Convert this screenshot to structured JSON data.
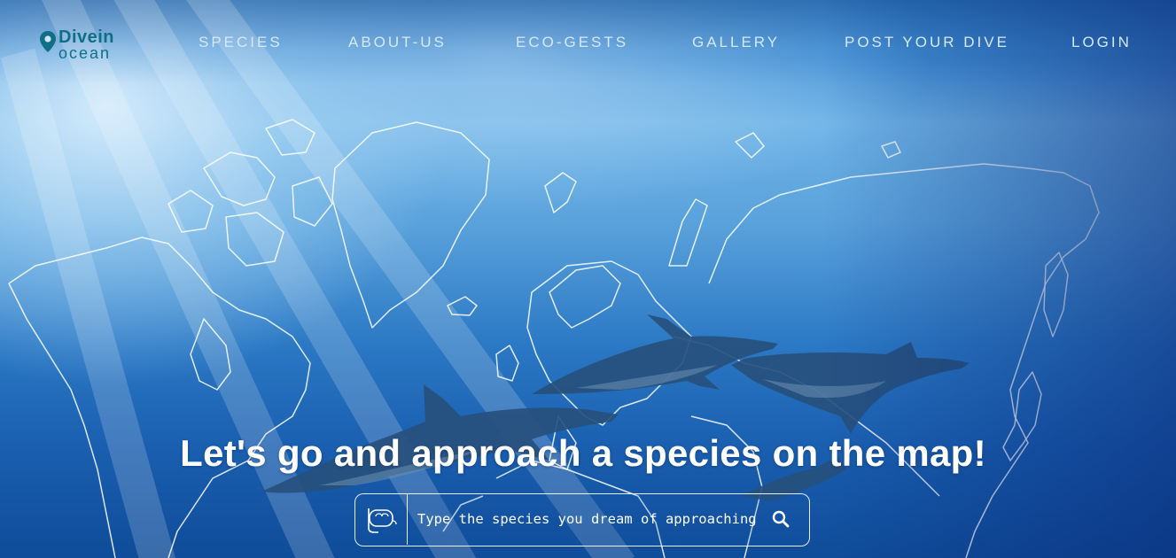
{
  "logo": {
    "line1": "Divein",
    "line2": "ocean"
  },
  "nav": {
    "items": [
      {
        "label": "SPECIES"
      },
      {
        "label": "ABOUT-US"
      },
      {
        "label": "ECO-GESTS"
      },
      {
        "label": "GALLERY"
      },
      {
        "label": "POST YOUR DIVE"
      },
      {
        "label": "LOGIN"
      }
    ]
  },
  "hero": {
    "headline": "Let's go and approach a species on the map!"
  },
  "search": {
    "placeholder": "Type the species you dream of approaching",
    "icon": "search-icon",
    "category_icon": "snorkel-mask-icon"
  },
  "colors": {
    "brand": "#0f6f87",
    "nav_text": "#d6e8f8",
    "headline": "#ffffff"
  }
}
